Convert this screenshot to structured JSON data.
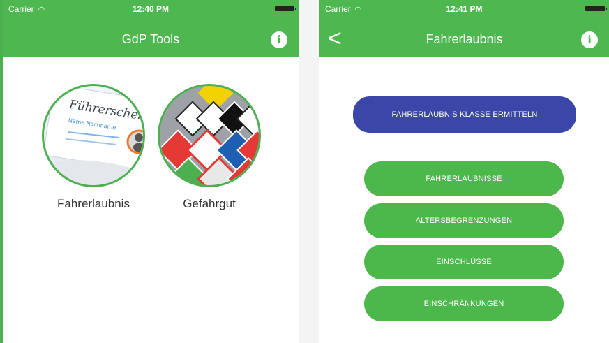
{
  "left_screen": {
    "status": {
      "carrier": "Carrier",
      "time": "12:40 PM"
    },
    "title": "GdP Tools",
    "info_icon": "i",
    "tiles": [
      {
        "label": "Fahrerlaubnis",
        "image_text": "Führerschein",
        "image_subtext": "Name Nachname"
      },
      {
        "label": "Gefahrgut"
      }
    ]
  },
  "right_screen": {
    "status": {
      "carrier": "Carrier",
      "time": "12:41 PM"
    },
    "title": "Fahrerlaubnis",
    "back_icon": "<",
    "info_icon": "i",
    "primary_button": "FAHRERLAUBNIS KLASSE ERMITTELN",
    "buttons": [
      "FAHRERLAUBNISSE",
      "ALTERSBEGRENZUNGEN",
      "EINSCHLÜSSE",
      "EINSCHRÄNKUNGEN"
    ]
  },
  "colors": {
    "bar_green": "#4fb74f",
    "button_green": "#4cb84c",
    "primary_blue": "#3a47a8"
  }
}
